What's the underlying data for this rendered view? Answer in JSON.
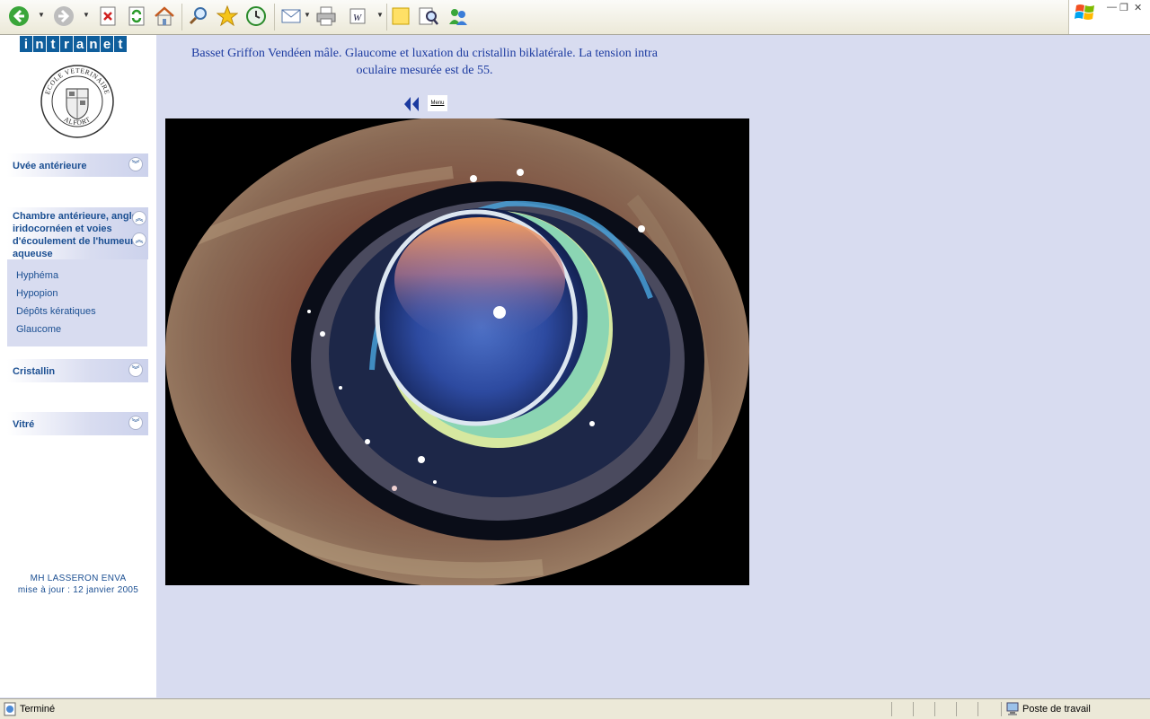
{
  "browser": {
    "toolbar_icons": [
      "back-icon",
      "forward-icon",
      "stop-icon",
      "refresh-icon",
      "home-icon",
      "search-icon",
      "favorites-icon",
      "history-icon",
      "mail-icon",
      "print-icon",
      "edit-word-icon",
      "notes-icon",
      "research-icon",
      "messenger-icon"
    ],
    "status_text": "Terminé",
    "zone_text": "Poste de travail"
  },
  "sidebar": {
    "banner_letters": [
      "i",
      "n",
      "t",
      "r",
      "a",
      "n",
      "e",
      "t"
    ],
    "seal_text_top": "ECOLE VETERINAIRE",
    "seal_text_bottom": "ALFORT",
    "menu": {
      "uvee": "Uvée antérieure",
      "chambre": "Chambre antérieure, angle iridocornéen et voies d'écoulement de l'humeur aqueuse",
      "chambre_items": [
        "Hyphéma",
        "Hypopion",
        "Dépôts kératiques",
        "Glaucome"
      ],
      "cristallin": "Cristallin",
      "vitre": "Vitré"
    },
    "credit_author": "MH LASSERON ENVA",
    "credit_update": "mise à jour : 12 janvier 2005"
  },
  "content": {
    "caption": "Basset Griffon Vendéen mâle. Glaucome et luxation du cristallin biklatérale. La tension intra oculaire mesurée est de 55.",
    "menu_link": "Menu"
  },
  "colors": {
    "page_bg": "#d8dcf0",
    "link_blue": "#1b4f92",
    "banner_blue": "#0f5e9c"
  }
}
